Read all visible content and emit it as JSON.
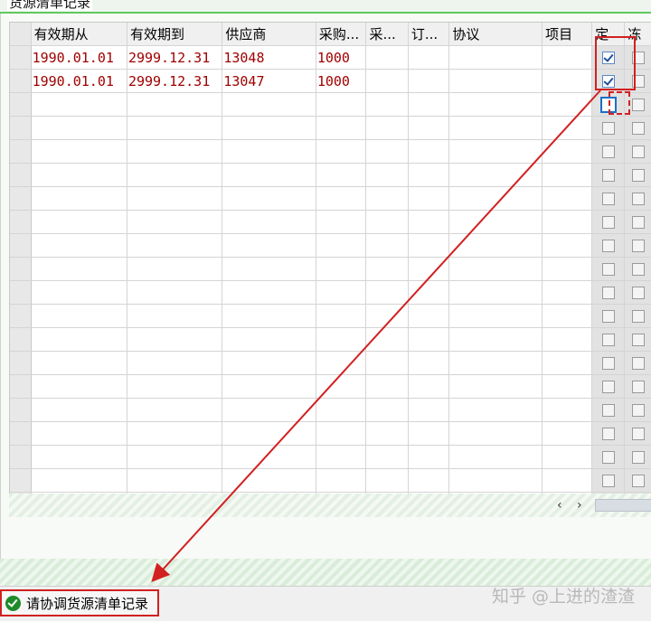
{
  "section_title": "货源清单记录",
  "columns": [
    "有效期从",
    "有效期到",
    "供应商",
    "采购...",
    "采...",
    "订...",
    "协议",
    "项目",
    "定",
    "冻"
  ],
  "rows": [
    {
      "valid_from": "1990.01.01",
      "valid_to": "2999.12.31",
      "vendor": "13048",
      "purch_org": "1000",
      "fixed": true
    },
    {
      "valid_from": "1990.01.01",
      "valid_to": "2999.12.31",
      "vendor": "13047",
      "purch_org": "1000",
      "fixed": true
    }
  ],
  "empty_row_count": 18,
  "scroll": {
    "left": "‹",
    "right": "›"
  },
  "status": {
    "message": "请协调货源清单记录",
    "icon": "ok-icon",
    "color": "#1f8a2a"
  },
  "watermark": "知乎 @上进的渣渣",
  "highlight_color": "#d22020"
}
